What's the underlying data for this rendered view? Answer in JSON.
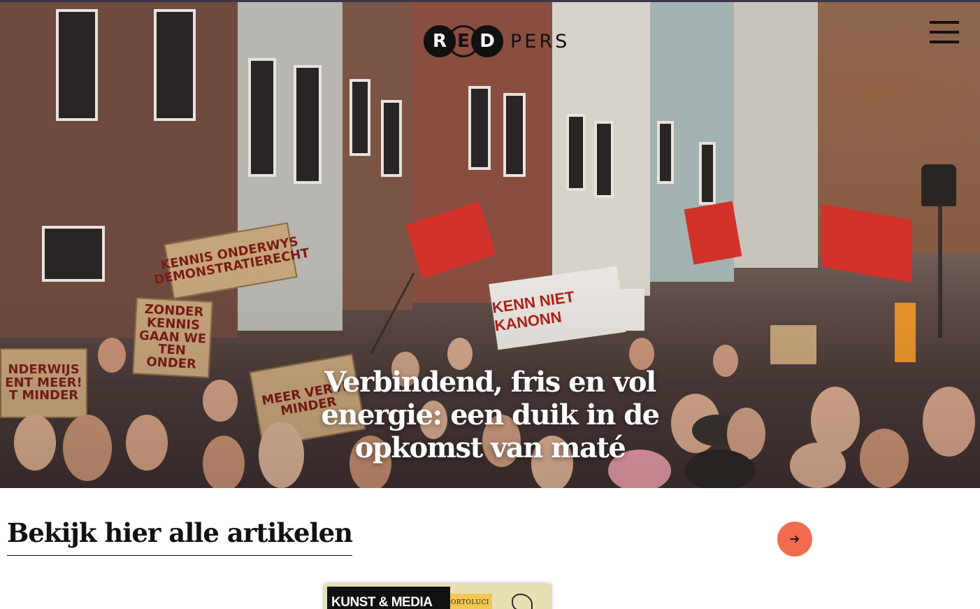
{
  "header": {
    "logo": {
      "letters": [
        "R",
        "E",
        "D"
      ],
      "word": "PERS"
    },
    "menu_icon": "hamburger-menu-icon"
  },
  "hero": {
    "title": "Verbindend, fris en vol energie: een duik in de opkomst van maté",
    "image": {
      "signs": [
        "KENNIS ONDERWYS DEMONSTRATIERECHT",
        "ZONDER KENNIS GAAN WE TEN ONDER",
        "NDERWIJS ENT MEER! T MINDER",
        "MEER VERVE MINDER",
        "KENN NIET IN KANONN"
      ]
    }
  },
  "articles_section": {
    "title": "Bekijk hier alle artikelen",
    "arrow_icon": "arrow-right-icon"
  },
  "card": {
    "category": "KUNST & MEDIA",
    "side_text": "ORTOLUCI"
  },
  "colors": {
    "accent": "#f26b4f",
    "top_line": "#3b3547",
    "flag_red": "#d3322b"
  }
}
